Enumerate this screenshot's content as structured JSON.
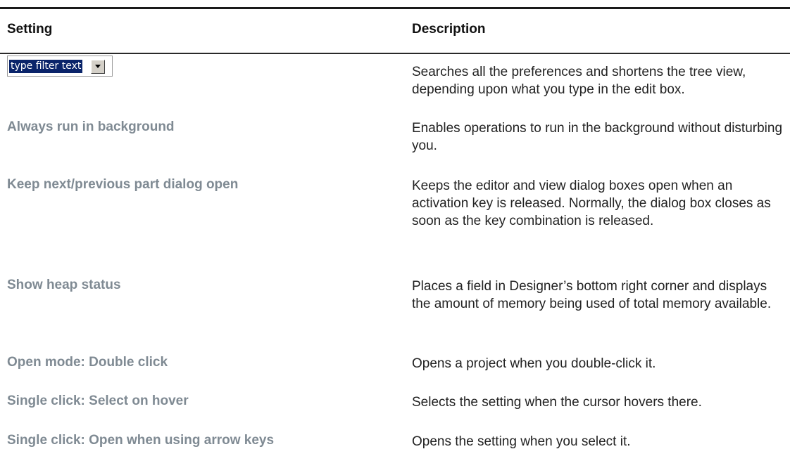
{
  "table": {
    "headers": {
      "setting": "Setting",
      "description": "Description"
    },
    "filter": {
      "value": "type filter text",
      "description": "Searches all the preferences and shortens the tree view, depending upon what you type in the edit box."
    },
    "rows": [
      {
        "setting": "Always run in background",
        "description": "Enables operations to run in the background without disturbing you."
      },
      {
        "setting": "Keep next/previous part dialog open",
        "description": "Keeps the editor and view dialog boxes open when an activation key is released. Normally, the dialog box closes as soon as the key combination is released."
      },
      {
        "setting": "Show heap status",
        "description": "Places a field in Designer’s bottom right corner and displays the amount of memory being used of total memory available."
      },
      {
        "setting": "Open mode: Double click",
        "description": "Opens a project when you double-click it."
      },
      {
        "setting": "Single click: Select on hover",
        "description": "Selects the setting when the cursor hovers there."
      },
      {
        "setting": "Single click: Open when using arrow keys",
        "description": "Opens the setting when you select it."
      }
    ]
  }
}
